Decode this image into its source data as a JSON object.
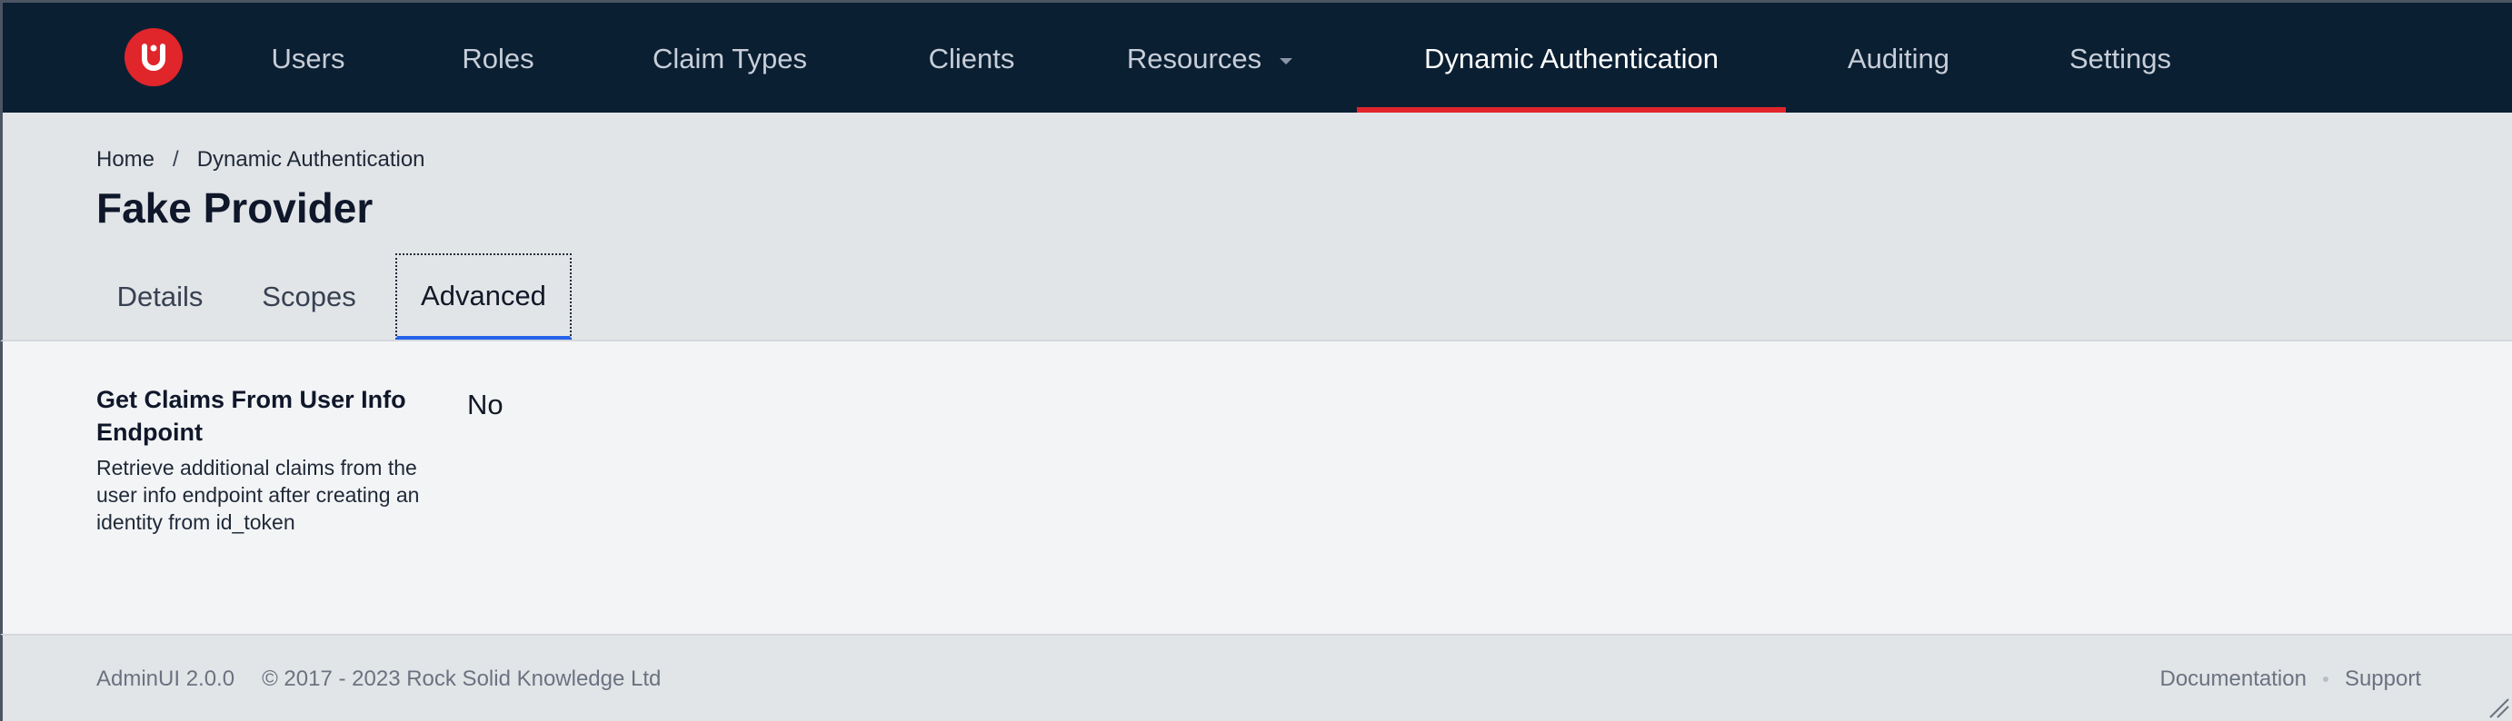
{
  "logo": {
    "text": "U",
    "icon": "adminui-logo-icon",
    "color": "#e0252b"
  },
  "nav": {
    "items": [
      {
        "label": "Users"
      },
      {
        "label": "Roles"
      },
      {
        "label": "Claim Types"
      },
      {
        "label": "Clients"
      },
      {
        "label": "Resources",
        "has_dropdown": true
      },
      {
        "label": "Dynamic Authentication",
        "active": true
      },
      {
        "label": "Auditing"
      },
      {
        "label": "Settings"
      }
    ]
  },
  "breadcrumb": {
    "home": "Home",
    "separator": "/",
    "current": "Dynamic Authentication"
  },
  "page": {
    "title": "Fake Provider"
  },
  "tabs": [
    {
      "label": "Details"
    },
    {
      "label": "Scopes"
    },
    {
      "label": "Advanced",
      "active": true
    }
  ],
  "field": {
    "label": "Get Claims From User Info Endpoint",
    "description": "Retrieve additional claims from the user info endpoint after creating an identity from id_token",
    "value": "No"
  },
  "footer": {
    "version": "AdminUI 2.0.0",
    "copyright": "© 2017 - 2023 Rock Solid Knowledge Ltd",
    "links": {
      "documentation": "Documentation",
      "support": "Support"
    }
  },
  "colors": {
    "nav_bg": "#0b1f33",
    "accent_red": "#e0252b",
    "tab_active": "#2563eb"
  }
}
